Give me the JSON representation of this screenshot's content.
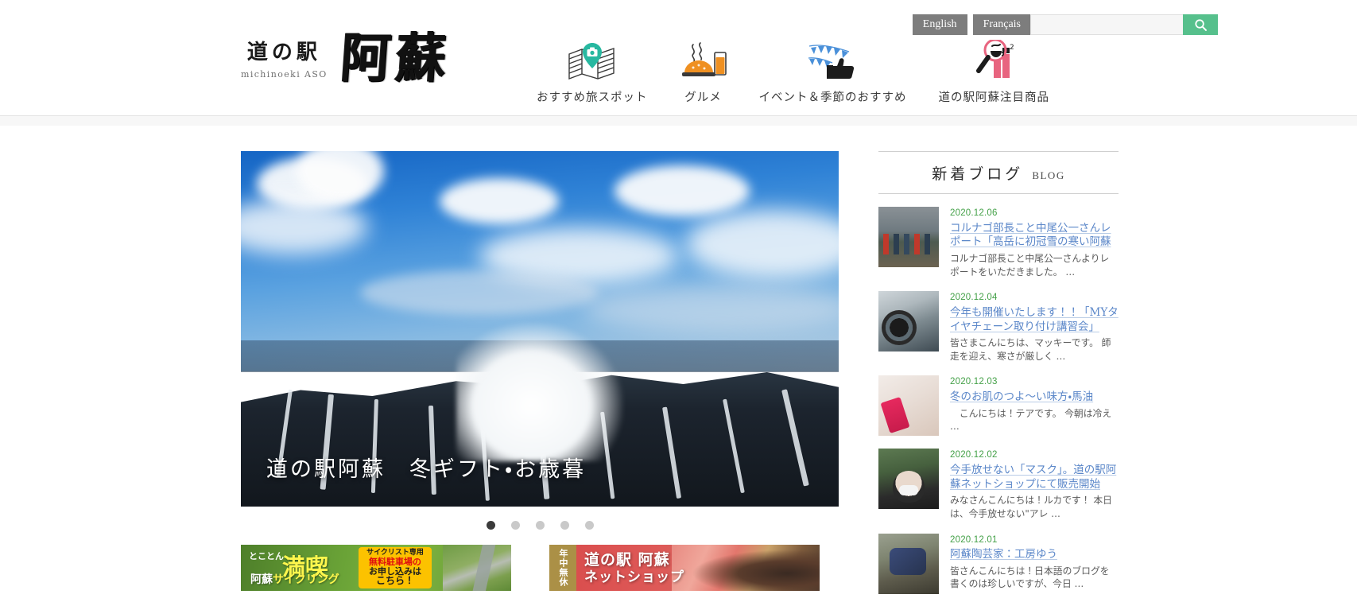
{
  "site": {
    "logo_ja": "道の駅",
    "logo_en": "michinoeki ASO",
    "logo_brush": "阿蘇"
  },
  "header": {
    "languages": [
      {
        "label": "English",
        "name": "lang-english"
      },
      {
        "label": "Français",
        "name": "lang-francais"
      }
    ],
    "search": {
      "value": "",
      "placeholder": "",
      "icon": "search-icon"
    },
    "nav": [
      {
        "label": "おすすめ旅スポット",
        "icon": "map-pin-camera-icon",
        "accent": "#27b8a0"
      },
      {
        "label": "グルメ",
        "icon": "food-drink-icon",
        "accent": "#ef9021"
      },
      {
        "label": "イベント＆季節のおすすめ",
        "icon": "bunting-thumbsup-icon",
        "accent": "#4a90d9"
      },
      {
        "label": "道の駅阿蘇注目商品",
        "icon": "magnifier-chart-icon",
        "accent": "#e8647f"
      }
    ]
  },
  "hero": {
    "caption": "道の駅阿蘇　冬ギフト・お歳暮",
    "prev_label": "‹",
    "next_label": "›",
    "slide_count": 5,
    "active_slide": 1
  },
  "banners": [
    {
      "name": "cycling-banner",
      "top_small": "とことん",
      "title_big": "満喫",
      "subtitle_prefix": "阿蘇",
      "subtitle_highlight": "サイクリング",
      "callout": {
        "line1": "サイクリスト専用",
        "line2": "無料駐車場の",
        "line3": "お申し込みは",
        "line4": "こちら！"
      }
    },
    {
      "name": "netshop-banner",
      "ribbon": "年中無休",
      "line1": "道の駅 阿蘇",
      "line2": "ネットショップ"
    }
  ],
  "blog": {
    "title_ja": "新着ブログ",
    "title_en": "BLOG",
    "posts": [
      {
        "date": "2020.12.06",
        "title": "コルナゴ部長こと中尾公一さんレポート「高岳に初冠雪の寒い阿蘇",
        "excerpt": "コルナゴ部長こと中尾公一さんよりレポートをいただきました。 …",
        "thumb": "t1"
      },
      {
        "date": "2020.12.04",
        "title": "今年も開催いたします！！「MYタイヤチェーン取り付け講習会」",
        "excerpt": "皆さまこんにちは、マッキーです。 師走を迎え、寒さが厳しく …",
        "thumb": "t2"
      },
      {
        "date": "2020.12.03",
        "title": "冬のお肌のつよ〜い味方・馬油",
        "excerpt": "　こんにちは！テアです。 今朝は冷え …",
        "thumb": "t3"
      },
      {
        "date": "2020.12.02",
        "title": "今手放せない「マスク」。道の駅阿蘇ネットショップにて販売開始",
        "excerpt": "みなさんこんにちは！ルカです！ 本日は、今手放せない\"アレ …",
        "thumb": "t4"
      },
      {
        "date": "2020.12.01",
        "title": "阿蘇陶芸家：工房ゆう",
        "excerpt": "皆さんこんにちは！日本語のブログを書くのは珍しいですが、今日 …",
        "thumb": "t5"
      }
    ]
  },
  "colors": {
    "search_button": "#56c08c",
    "lang_button": "#7d7d7d",
    "post_date": "#43a047",
    "post_title": "#5b87c9"
  }
}
